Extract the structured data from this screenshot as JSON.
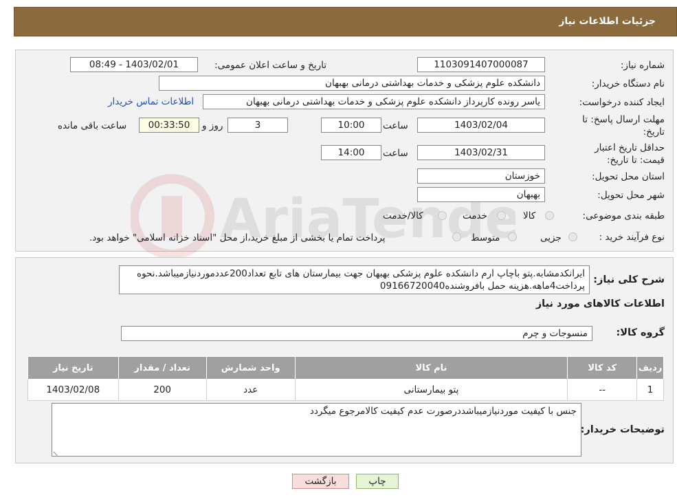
{
  "header": {
    "title": "جزئیات اطلاعات نیاز"
  },
  "form": {
    "need_no_label": "شماره نیاز:",
    "need_no": "1103091407000087",
    "announce_label": "تاریخ و ساعت اعلان عمومی:",
    "announce_value": "1403/02/01 - 08:49",
    "buyer_label": "نام دستگاه خریدار:",
    "buyer_value": "دانشکده علوم پزشکی و خدمات بهداشتی  درمانی بهبهان",
    "creator_label": "ایجاد کننده درخواست:",
    "creator_value": "یاسر رونده کارپرداز دانشکده علوم پزشکی و خدمات بهداشتی  درمانی بهبهان",
    "contact_link": "اطلاعات تماس خریدار",
    "deadline_label": "مهلت ارسال پاسخ: تا تاریخ:",
    "deadline_date": "1403/02/04",
    "time_label": "ساعت",
    "deadline_time": "10:00",
    "days_value": "3",
    "days_label": "روز و",
    "remaining_value": "00:33:50",
    "remaining_label": "ساعت باقی مانده",
    "validity_label": "حداقل تاریخ اعتبار قیمت: تا تاریخ:",
    "validity_date": "1403/02/31",
    "validity_time": "14:00",
    "province_label": "استان محل تحویل:",
    "province_value": "خوزستان",
    "city_label": "شهر محل تحویل:",
    "city_value": "بهبهان",
    "category_label": "طبقه بندی موضوعی:",
    "category_options": [
      "کالا",
      "خدمت",
      "کالا/خدمت"
    ],
    "process_label": "نوع فرآیند خرید :",
    "process_options": [
      "جزیی",
      "متوسط"
    ],
    "process_note": "پرداخت تمام یا بخشی از مبلغ خرید،از محل \"اسناد خزانه اسلامی\" خواهد بود."
  },
  "details": {
    "desc_label": "شرح کلی نیاز:",
    "desc_text": "ایرانکدمشابه.پتو باچاپ ارم دانشکده علوم پزشکی بهبهان جهت بیمارستان های تابع تعداد200عددموردنیازمیباشد.نحوه پرداخت4ماهه.هزینه حمل بافروشنده09166720040",
    "items_title": "اطلاعات کالاهای مورد نیاز",
    "group_label": "گروه کالا:",
    "group_value": "منسوجات و چرم",
    "table": {
      "headers": [
        "ردیف",
        "کد کالا",
        "نام کالا",
        "واحد شمارش",
        "تعداد / مقدار",
        "تاریخ نیاز"
      ],
      "rows": [
        [
          "1",
          "--",
          "پتو بیمارستانی",
          "عدد",
          "200",
          "1403/02/08"
        ]
      ]
    },
    "buyer_notes_label": "توضیحات خریدار:",
    "buyer_notes": "جنس با کیفیت موردنیازمیباشددرصورت عدم کیفیت کالامرجوع میگردد"
  },
  "buttons": {
    "print": "چاپ",
    "back": "بازگشت"
  },
  "colors": {
    "header": "#8b6a3e",
    "link": "#1a4fbf",
    "print_btn": "#e6f5d5",
    "back_btn": "#f9dede"
  }
}
